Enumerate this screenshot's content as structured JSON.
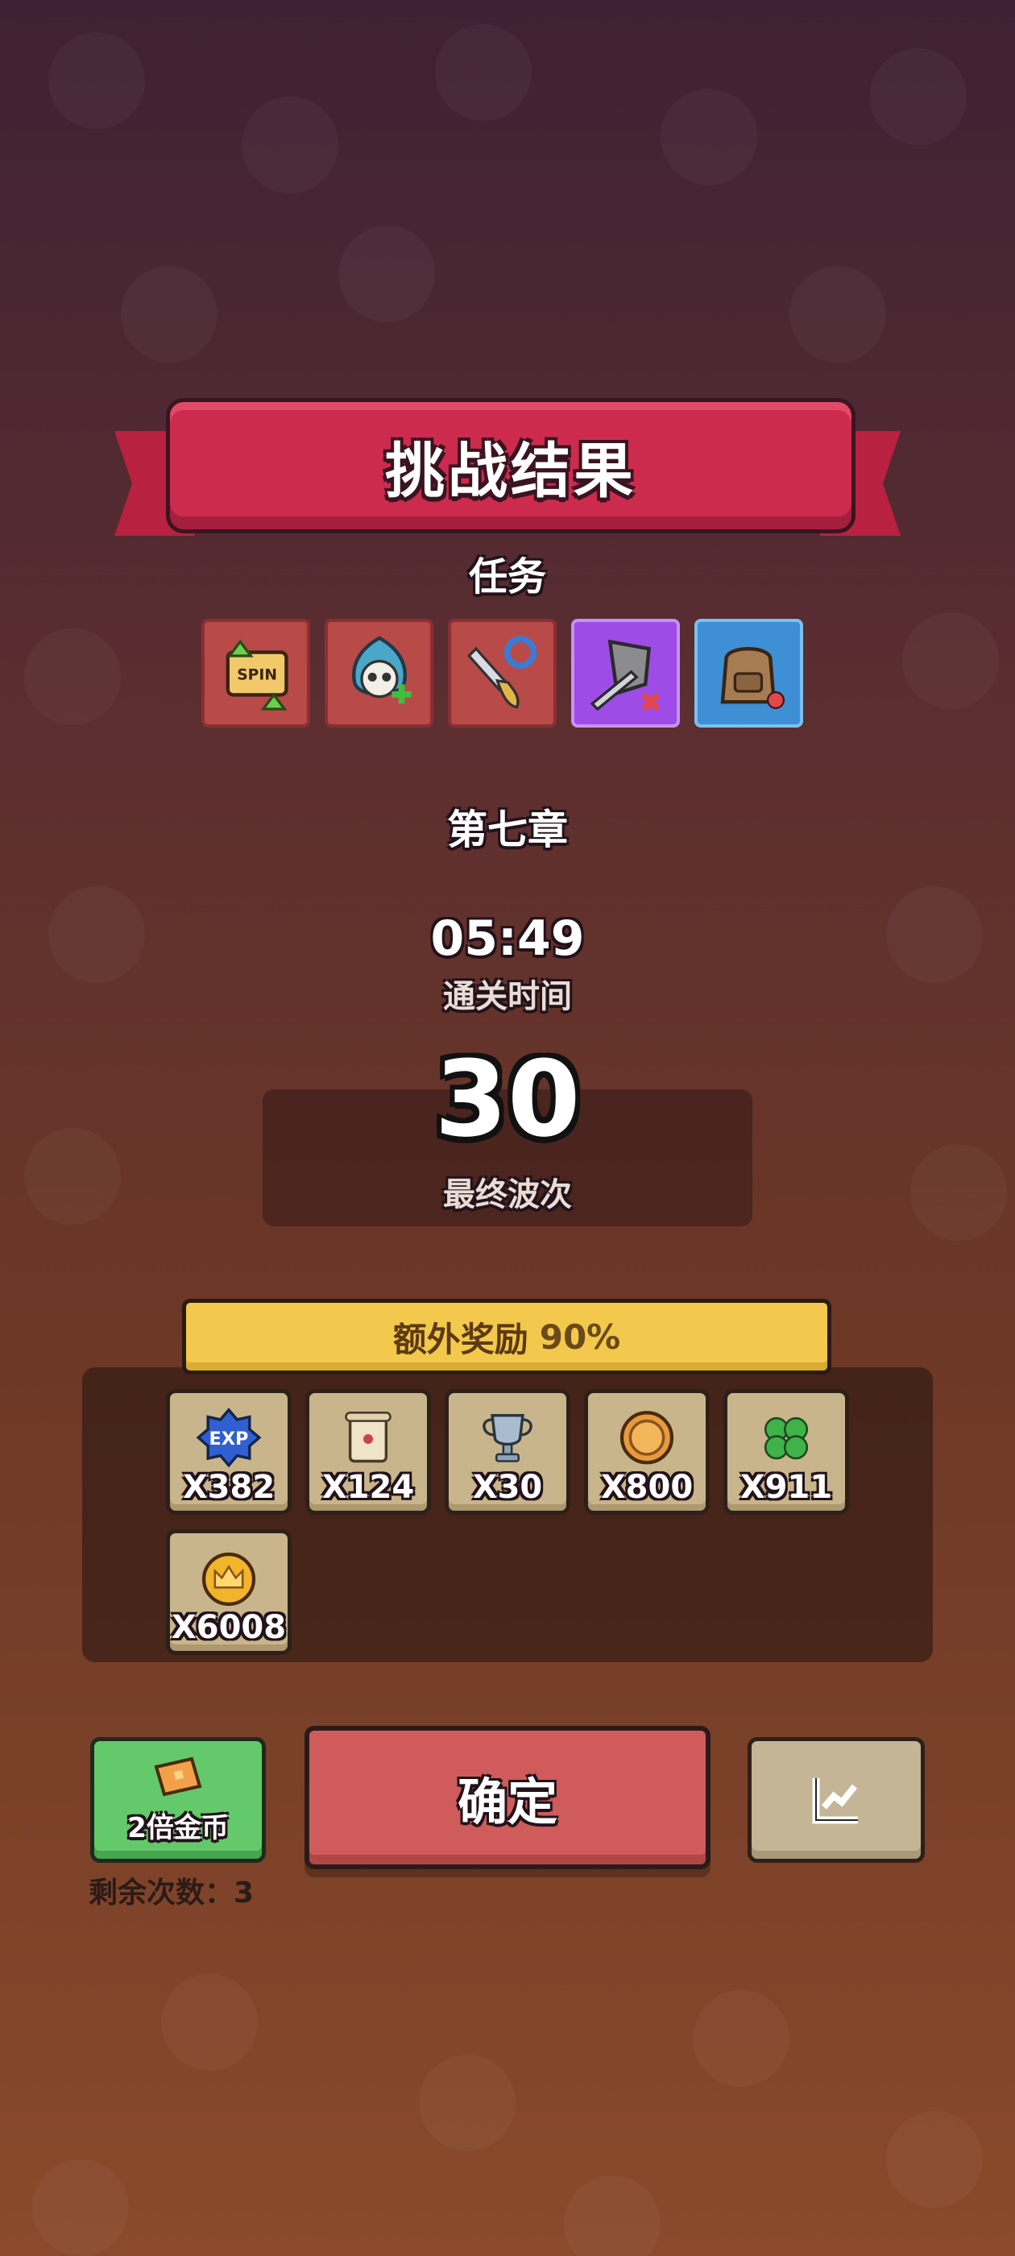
{
  "header": {
    "title": "挑战结果"
  },
  "missions": {
    "label": "任务",
    "items": [
      {
        "icon": "spin-upgrade-icon",
        "style": "red"
      },
      {
        "icon": "skull-plus-icon",
        "style": "red"
      },
      {
        "icon": "sword-refresh-icon",
        "style": "red"
      },
      {
        "icon": "shield-sword-icon",
        "style": "purple"
      },
      {
        "icon": "backpack-icon",
        "style": "blue"
      }
    ]
  },
  "chapter": "第七章",
  "clear_time": {
    "value": "05:49",
    "label": "通关时间"
  },
  "final_wave": {
    "value": "30",
    "label": "最终波次"
  },
  "bonus": {
    "label": "额外奖励",
    "percent": "90%"
  },
  "rewards": [
    {
      "icon": "exp-icon",
      "qty": "X382"
    },
    {
      "icon": "scroll-icon",
      "qty": "X124"
    },
    {
      "icon": "trophy-icon",
      "qty": "X30"
    },
    {
      "icon": "coin-icon",
      "qty": "X800"
    },
    {
      "icon": "clover-icon",
      "qty": "X911"
    },
    {
      "icon": "crown-coin-icon",
      "qty": "X6008"
    }
  ],
  "buttons": {
    "double_gold": "2倍金币",
    "confirm": "确定",
    "stats_icon": "stats-chart-icon"
  },
  "remaining": "剩余次数：3",
  "colors": {
    "ribbon": "#cd2b4d",
    "bonus_bar": "#f2c94c",
    "confirm": "#cf5b5b",
    "double": "#63c96a"
  }
}
